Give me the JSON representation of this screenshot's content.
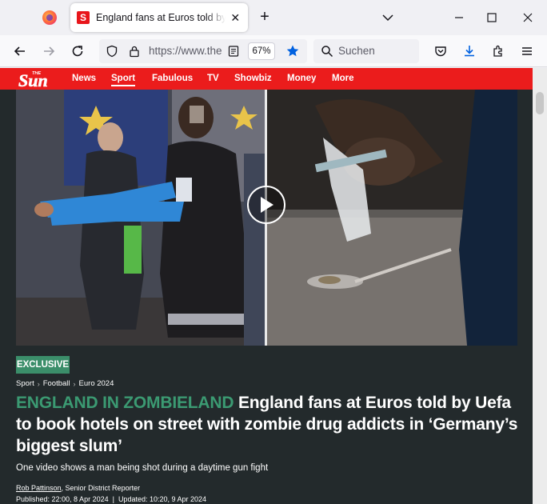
{
  "browser": {
    "tab_title": "England fans at Euros told by Uefa to book hotels on street with zombie drug addicts in 'Germany's biggest slum'",
    "favicon_letter": "S",
    "url": "https://www.thesun.co.uk",
    "zoom": "67%",
    "search_placeholder": "Suchen"
  },
  "site": {
    "logo_text": "Sun",
    "logo_small": "THE",
    "nav": [
      "News",
      "Sport",
      "Fabulous",
      "TV",
      "Showbiz",
      "Money",
      "More"
    ],
    "active_nav": "Sport"
  },
  "article": {
    "badge": "EXCLUSIVE",
    "breadcrumb": [
      "Sport",
      "Football",
      "Euro 2024"
    ],
    "kicker": "ENGLAND IN ZOMBIELAND",
    "headline": "England fans at Euros told by Uefa to book hotels on street with zombie drug addicts in ‘Germany’s biggest slum’",
    "standfirst": "One video shows a man being shot during a daytime gun fight",
    "author": "Rob Pattinson",
    "author_role": ", Senior District Reporter",
    "published": "Published: 22:00, 8 Apr 2024",
    "updated": "Updated: 10:20, 9 Apr 2024"
  },
  "colors": {
    "sun_red": "#eb1c1c",
    "kicker_green": "#3b9a72",
    "page_bg": "#232a2c"
  }
}
